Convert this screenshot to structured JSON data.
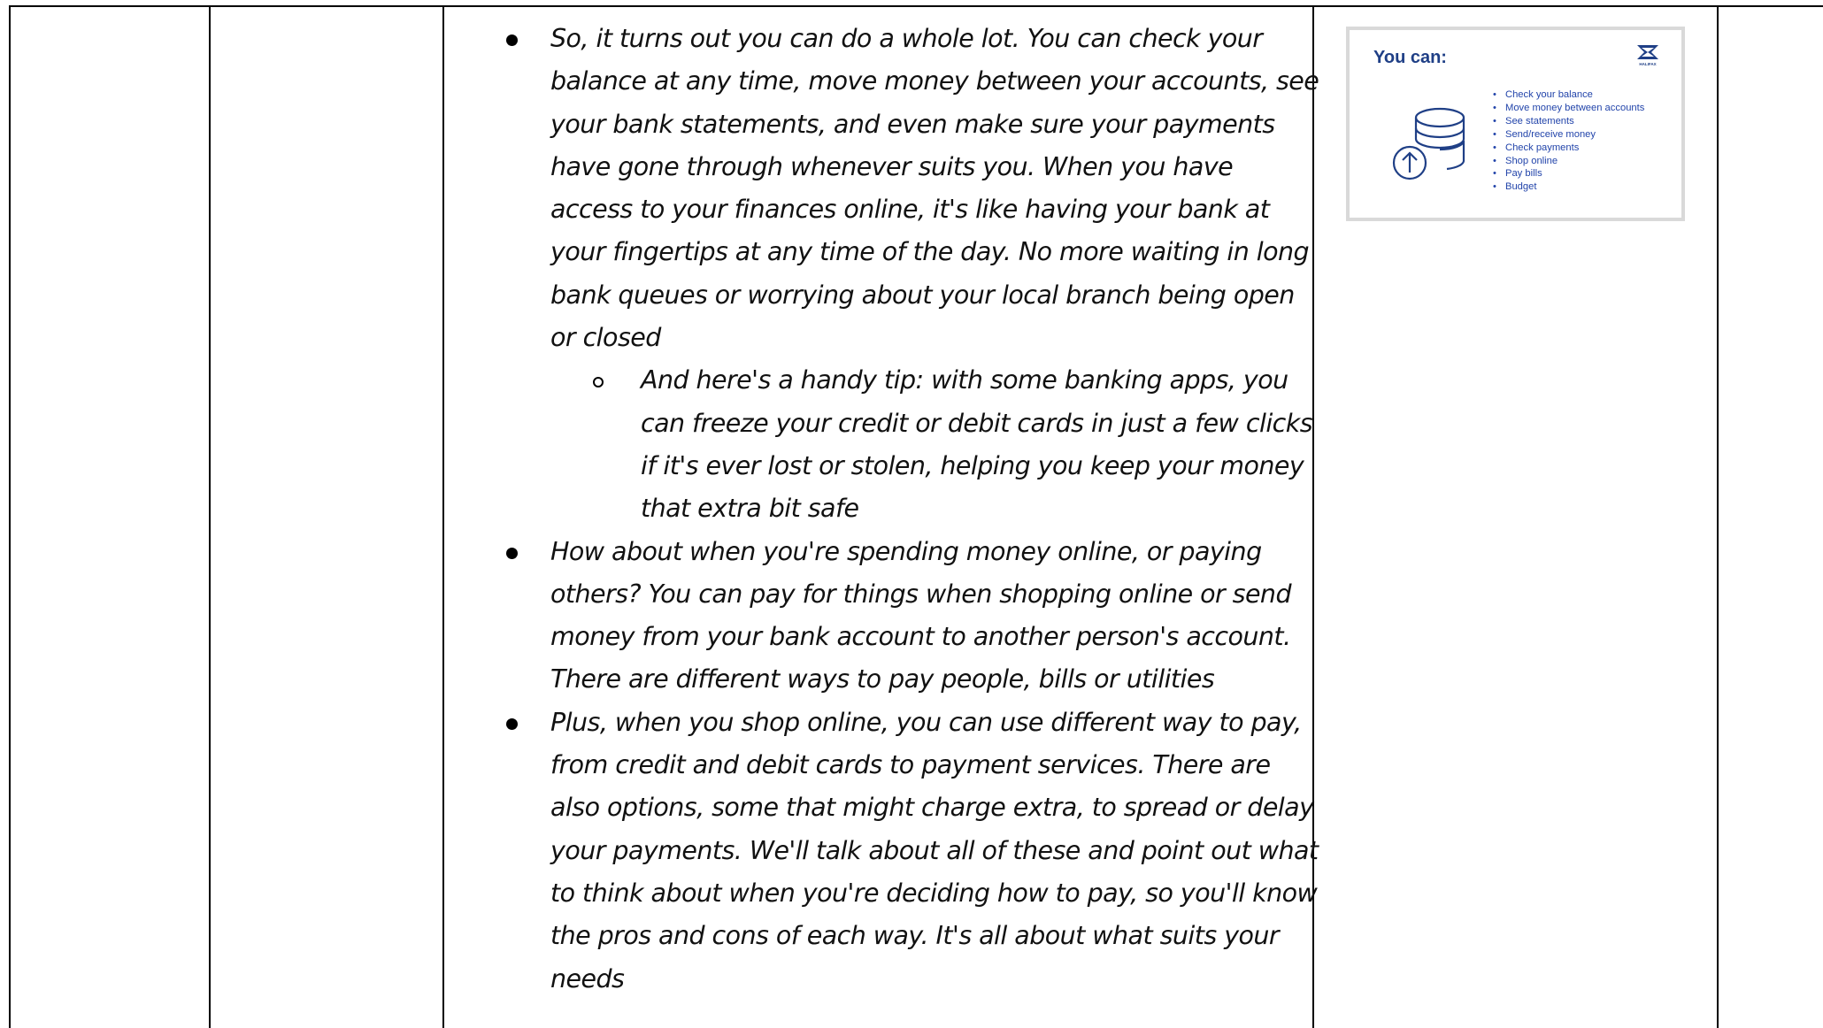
{
  "script": {
    "bullets": [
      {
        "text": "So, it turns out  you can do a whole lot. You can check your balance at any time, move money between your accounts, see your bank statements, and even make sure your payments have gone through whenever suits you. When you have access to your finances online, it's like having your bank at your fingertips at any time of the day. No more waiting in long bank queues or worrying about your local branch being open or closed",
        "sub": [
          "And here's a handy tip: with some banking apps, you can freeze your credit or debit cards in just a few clicks if it's ever lost or stolen, helping you keep your money that extra bit safe"
        ]
      },
      {
        "text": "How about when you're spending money online, or paying others? You can pay for things when shopping online or send money from your bank account to another person's account. There are different ways to pay people, bills or utilities"
      },
      {
        "text": "Plus, when you shop online, you can use different way to pay, from credit and debit cards to payment services. There are also options, some that might charge extra, to spread or delay your payments. We'll talk about all of these and point out what to think about when you're deciding how to pay, so you'll know the pros and cons of each way. It's all about what suits your needs"
      }
    ]
  },
  "slide": {
    "title": "You can:",
    "logo_text": "HALIFAX",
    "icon": "coins-stack-upload-icon",
    "items": [
      "Check your balance",
      "Move money between accounts",
      "See statements",
      "Send/receive money",
      "Check payments",
      "Shop online",
      "Pay bills",
      "Budget"
    ],
    "colors": {
      "title": "#1f3f86",
      "items": "#2244aa",
      "border": "#d9d9d9"
    }
  }
}
